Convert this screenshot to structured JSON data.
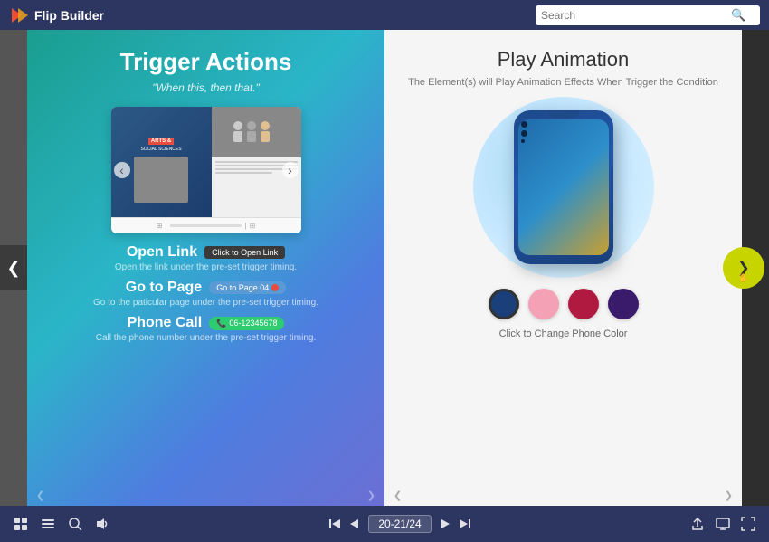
{
  "app": {
    "name": "Flip Builder"
  },
  "topbar": {
    "search_placeholder": "Search"
  },
  "left_page": {
    "title": "Trigger Actions",
    "subtitle": "\"When this, then that.\"",
    "actions": [
      {
        "name": "Open Link",
        "btn_label": "Click to Open Link",
        "desc": "Open the link under the pre-set trigger timing."
      },
      {
        "name": "Go to Page",
        "btn_label": "Go to Page 04",
        "desc": "Go to the paticular page under the pre-set trigger timing."
      },
      {
        "name": "Phone Call",
        "btn_label": "06-12345678",
        "desc": "Call the phone number under the pre-set trigger timing."
      }
    ]
  },
  "right_page": {
    "title": "Play Animation",
    "desc": "The Element(s) will Play Animation Effects When Trigger the Condition",
    "swatch_label": "Click to Change Phone Color",
    "swatches": [
      {
        "color": "#1a3f7a",
        "active": true
      },
      {
        "color": "#f4a0b5",
        "active": false
      },
      {
        "color": "#b01a40",
        "active": false
      },
      {
        "color": "#3a1a6b",
        "active": false
      }
    ]
  },
  "bottom_toolbar": {
    "page_indicator": "20-21/24",
    "buttons": {
      "grid": "⊞",
      "list": "≡",
      "zoom": "⊙",
      "sound": "♪",
      "first": "⏮",
      "prev": "◀",
      "next": "▶",
      "last": "⏭",
      "share": "⬆",
      "fullscreen": "⛶",
      "expand": "⤢"
    }
  },
  "nav": {
    "left_arrow": "❮",
    "right_arrow": "❯"
  }
}
